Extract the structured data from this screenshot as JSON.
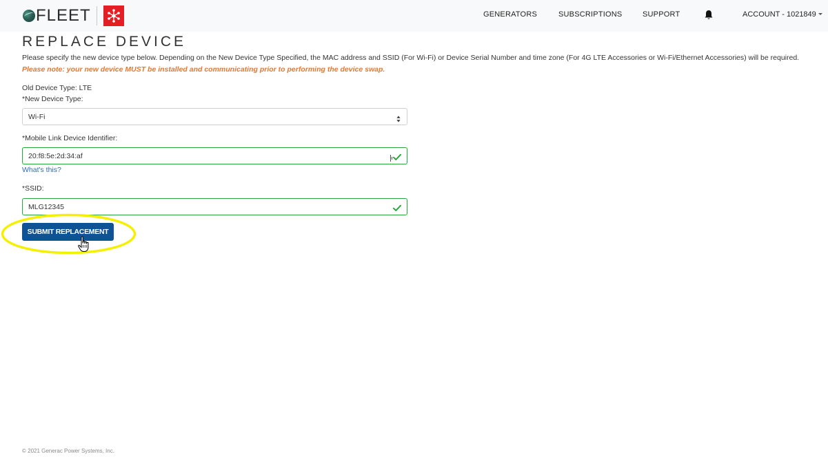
{
  "header": {
    "brand": "FLEET",
    "nav": {
      "generators": "GENERATORS",
      "subscriptions": "SUBSCRIPTIONS",
      "support": "SUPPORT",
      "account": "ACCOUNT - 1021849"
    }
  },
  "page": {
    "title": "REPLACE DEVICE",
    "intro": "Please specify the new device type below. Depending on the New Device Type Specified, the MAC address and SSID (For Wi-Fi) or Device Serial Number and time zone (For 4G LTE Accessories or Wi-Fi/Ethernet Accessories) will be required.",
    "note": "Please note: your new device MUST be installed and communicating prior to performing the device swap."
  },
  "form": {
    "old_device_type": "Old Device Type: LTE",
    "new_device_type_label": "*New Device Type:",
    "new_device_type_value": "Wi-Fi",
    "mlid_label": "*Mobile Link Device Identifier:",
    "mlid_value": "20:f8:5e:2d:34:af",
    "whats_this": "What's this?",
    "ssid_label": "*SSID:",
    "ssid_value": "MLG12345",
    "submit_label": "SUBMIT REPLACEMENT"
  },
  "footer": {
    "copyright": "© 2021 Generac Power Systems, Inc."
  },
  "colors": {
    "accent": "#0f5394",
    "valid": "#2aa63f",
    "note": "#e8772e",
    "link": "#2f6db5",
    "highlight": "#f5f000",
    "brand_red": "#e31e24"
  }
}
